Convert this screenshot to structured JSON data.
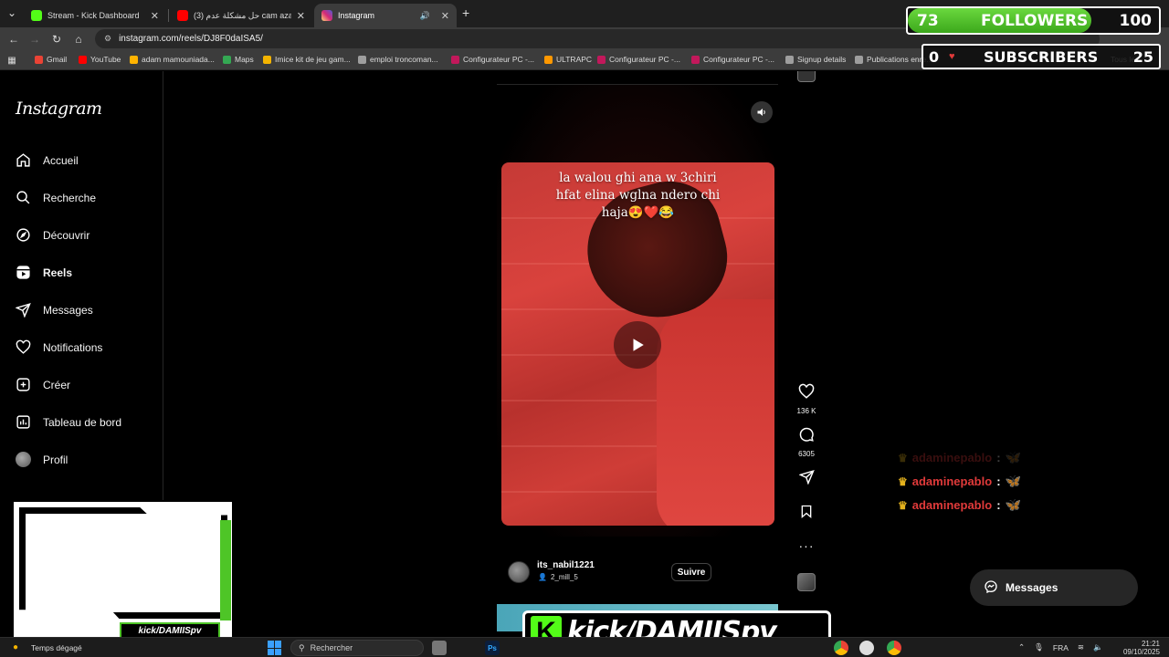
{
  "browser": {
    "tabs": [
      {
        "title": "Stream - Kick Dashboard",
        "color": "#53fc18",
        "active": false
      },
      {
        "title": "حل مشكلة عدم (3) cam azaar كـ",
        "color": "#ff0000",
        "active": false
      },
      {
        "title": "Instagram",
        "color": "#e1306c",
        "active": true
      }
    ],
    "new_tab_label": "+",
    "url": "instagram.com/reels/DJ8F0daISA5/",
    "bookmarks": [
      {
        "label": "Gmail",
        "color": "#ea4335"
      },
      {
        "label": "YouTube",
        "color": "#ff0000"
      },
      {
        "label": "adam mamouniada...",
        "color": "#ffb300"
      },
      {
        "label": "Maps",
        "color": "#34a853"
      },
      {
        "label": "Imice kit de jeu gam...",
        "color": "#f4b400"
      },
      {
        "label": "emploi troncoman...",
        "color": "#9e9e9e"
      },
      {
        "label": "Configurateur PC -...",
        "color": "#c2185b"
      },
      {
        "label": "ULTRAPC",
        "color": "#ff9800"
      },
      {
        "label": "Configurateur PC -...",
        "color": "#c2185b"
      },
      {
        "label": "Configurateur PC -...",
        "color": "#c2185b"
      },
      {
        "label": "Signup details",
        "color": "#9e9e9e"
      },
      {
        "label": "Publications enre...",
        "color": "#9e9e9e"
      }
    ],
    "all_bookmarks": "Tous les"
  },
  "instagram": {
    "logo": "Instagram",
    "nav": [
      {
        "label": "Accueil",
        "icon": "home-icon"
      },
      {
        "label": "Recherche",
        "icon": "search-icon"
      },
      {
        "label": "Découvrir",
        "icon": "compass-icon"
      },
      {
        "label": "Reels",
        "icon": "reels-icon"
      },
      {
        "label": "Messages",
        "icon": "send-icon"
      },
      {
        "label": "Notifications",
        "icon": "heart-icon"
      },
      {
        "label": "Créer",
        "icon": "plus-square-icon"
      },
      {
        "label": "Tableau de bord",
        "icon": "chart-icon"
      },
      {
        "label": "Profil",
        "icon": "avatar-icon"
      }
    ],
    "reel": {
      "caption_lines": [
        "la walou ghi ana w 3chiri",
        "hfat elina wglna ndero chi",
        "haja😍❤️😂"
      ],
      "likes": "136 K",
      "comments": "6305",
      "username": "its_nabil1221",
      "audio": "2_mill_5",
      "follow_label": "Suivre"
    },
    "messages_label": "Messages"
  },
  "overlay": {
    "followers_current": "73",
    "followers_label": "FOLLOWERS",
    "followers_goal": "100",
    "followers_progress": 0.73,
    "subs_current": "0",
    "subs_label": "SUBSCRIBERS",
    "subs_goal": "25",
    "chat": [
      {
        "user": "adaminepablo",
        "sep": ":",
        "emote": "🦋",
        "faded": true
      },
      {
        "user": "adaminepablo",
        "sep": ":",
        "emote": "🦋",
        "faded": false
      },
      {
        "user": "adaminepablo",
        "sep": ":",
        "emote": "🦋",
        "faded": false
      }
    ],
    "cam_label": "kick/DAMIISpv",
    "banner_k": "K",
    "banner_text": "kick/DAMIISpv"
  },
  "taskbar": {
    "weather": "Temps dégagé",
    "search_placeholder": "Rechercher",
    "lang": "FRA",
    "time": "21:21",
    "date": "09/10/2025"
  },
  "colors": {
    "kick_green": "#53fc18",
    "follower_green": "#4ec527",
    "chat_user": "#e03a3a",
    "crown": "#e4b21d"
  }
}
